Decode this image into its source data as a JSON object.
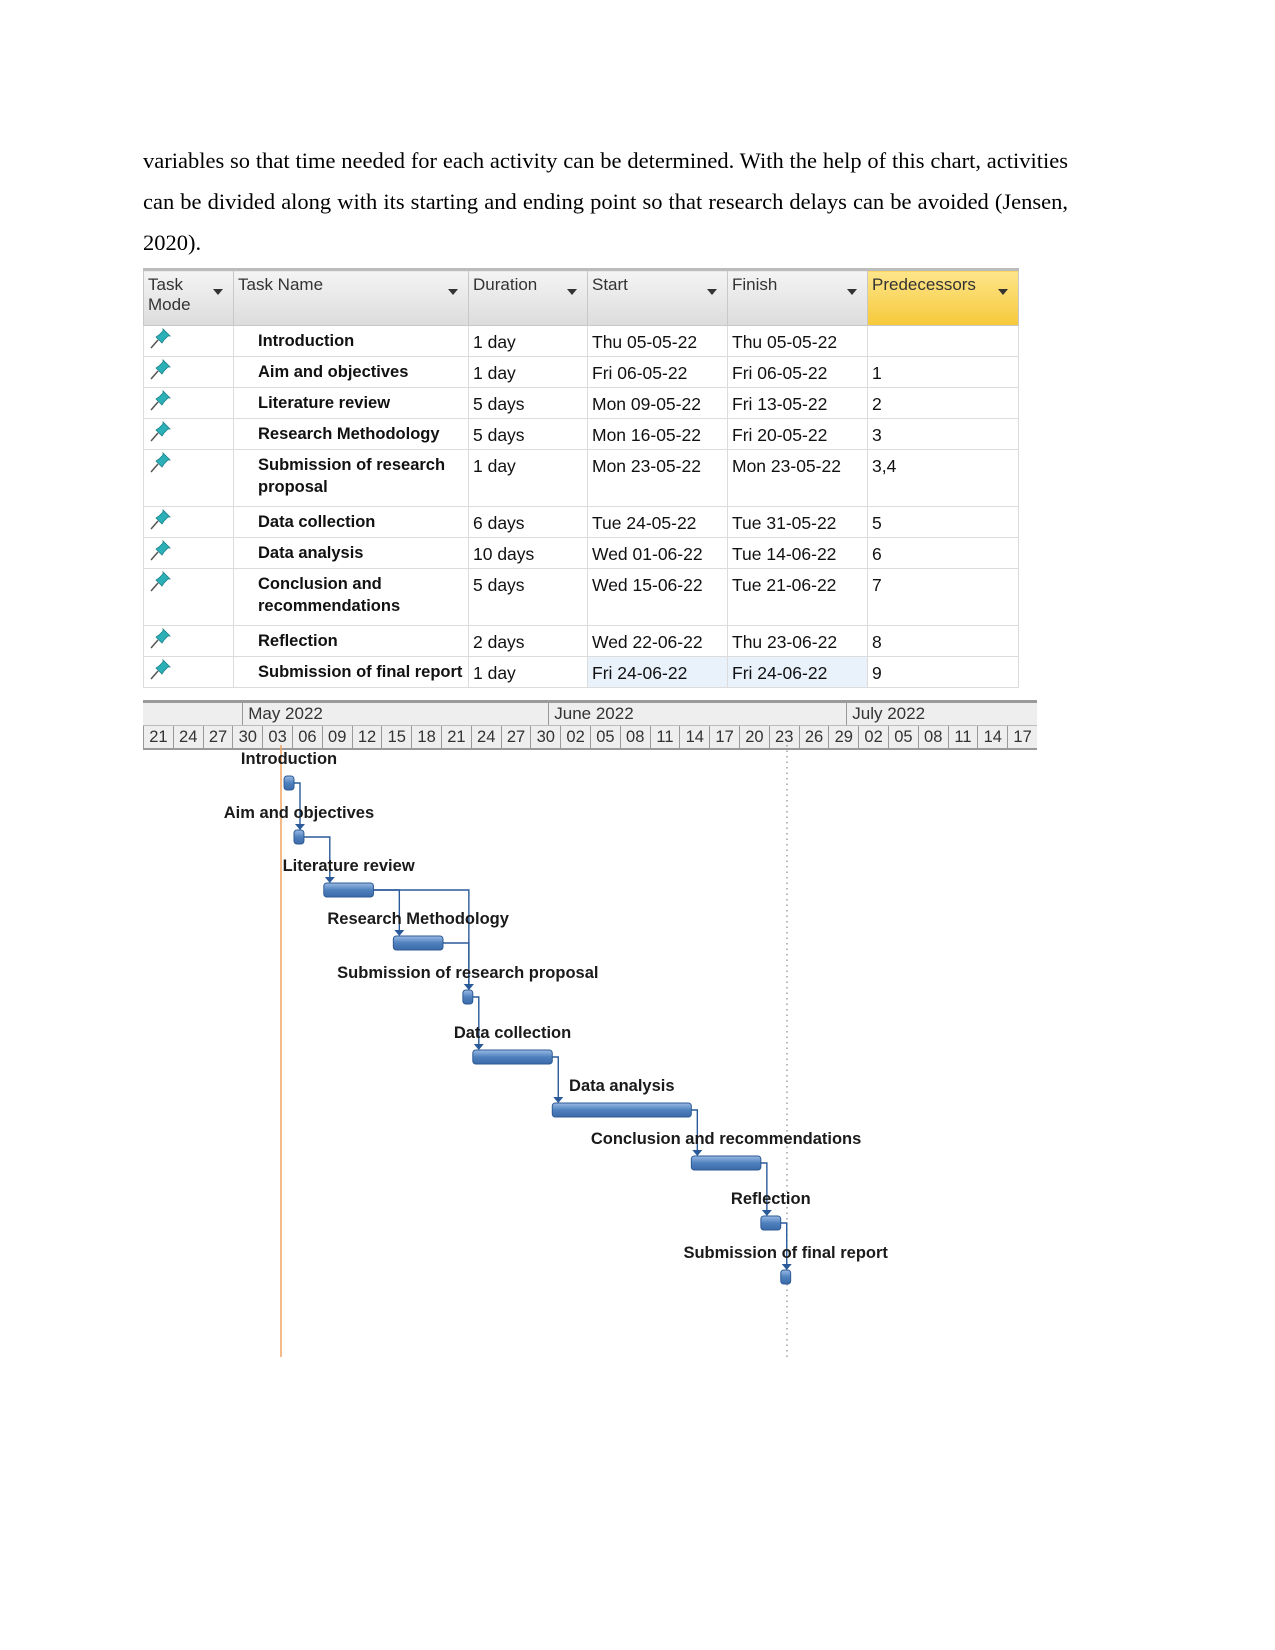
{
  "paragraph": "variables so that time needed for each activity can be determined. With the help of this chart, activities can be divided along with its starting and ending point so that research delays can be avoided (Jensen, 2020).",
  "table": {
    "headers": [
      "Task Mode",
      "Task Name",
      "Duration",
      "Start",
      "Finish",
      "Predecessors"
    ],
    "rows": [
      {
        "name": "Introduction",
        "duration": "1 day",
        "start": "Thu 05-05-22",
        "finish": "Thu 05-05-22",
        "pred": ""
      },
      {
        "name": "Aim and objectives",
        "duration": "1 day",
        "start": "Fri 06-05-22",
        "finish": "Fri 06-05-22",
        "pred": "1"
      },
      {
        "name": "Literature review",
        "duration": "5 days",
        "start": "Mon 09-05-22",
        "finish": "Fri 13-05-22",
        "pred": "2"
      },
      {
        "name": "Research Methodology",
        "duration": "5 days",
        "start": "Mon 16-05-22",
        "finish": "Fri 20-05-22",
        "pred": "3"
      },
      {
        "name": "Submission of research proposal",
        "duration": "1 day",
        "start": "Mon 23-05-22",
        "finish": "Mon 23-05-22",
        "pred": "3,4"
      },
      {
        "name": "Data collection",
        "duration": "6 days",
        "start": "Tue 24-05-22",
        "finish": "Tue 31-05-22",
        "pred": "5"
      },
      {
        "name": "Data analysis",
        "duration": "10 days",
        "start": "Wed 01-06-22",
        "finish": "Tue 14-06-22",
        "pred": "6"
      },
      {
        "name": "Conclusion and recommendations",
        "duration": "5 days",
        "start": "Wed 15-06-22",
        "finish": "Tue 21-06-22",
        "pred": "7"
      },
      {
        "name": "Reflection",
        "duration": "2 days",
        "start": "Wed 22-06-22",
        "finish": "Thu 23-06-22",
        "pred": "8"
      },
      {
        "name": "Submission of final report",
        "duration": "1 day",
        "start": "Fri 24-06-22",
        "finish": "Fri 24-06-22",
        "pred": "9"
      }
    ],
    "task_mode_icon": "pushpin-icon",
    "pin_color": "#2bb0b8",
    "pred_header_color": "#f7c93a"
  },
  "timescale": {
    "months": [
      "May 2022",
      "June 2022",
      "July 2022"
    ],
    "days": [
      "21",
      "24",
      "27",
      "30",
      "03",
      "06",
      "09",
      "12",
      "15",
      "18",
      "21",
      "24",
      "27",
      "30",
      "02",
      "05",
      "08",
      "11",
      "14",
      "17",
      "20",
      "23",
      "26",
      "29",
      "02",
      "05",
      "08",
      "11",
      "14",
      "17"
    ]
  },
  "gantt": {
    "labels": [
      "Introduction",
      "Aim and objectives",
      "Literature review",
      "Research Methodology",
      "Submission of research proposal",
      "Data collection",
      "Data analysis",
      "Conclusion and recommendations",
      "Reflection",
      "Submission of final report"
    ],
    "bar_color": "#4f81bd",
    "today_line_color": "#f4a460"
  }
}
